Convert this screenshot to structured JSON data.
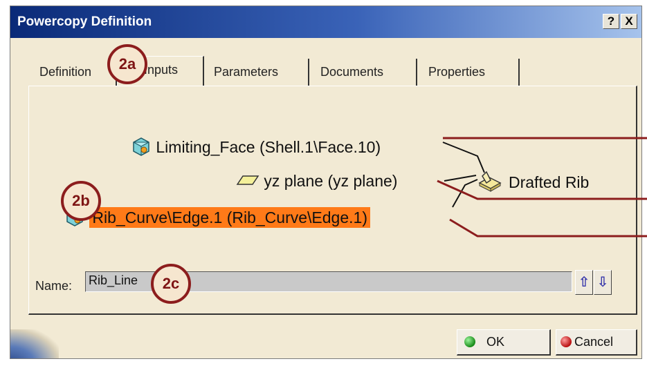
{
  "window": {
    "title": "Powercopy Definition",
    "help_label": "?",
    "close_label": "X"
  },
  "tabs": [
    {
      "label": "Definition",
      "active": false
    },
    {
      "label": "Inputs",
      "active": true
    },
    {
      "label": "Parameters",
      "active": false
    },
    {
      "label": "Documents",
      "active": false
    },
    {
      "label": "Properties",
      "active": false
    }
  ],
  "tree": {
    "inputs": [
      {
        "label": "Limiting_Face (Shell.1\\Face.10)",
        "icon": "face-icon"
      },
      {
        "label": "yz plane (yz plane)",
        "icon": "plane-icon"
      },
      {
        "label": "Rib_Curve\\Edge.1 (Rib_Curve\\Edge.1)",
        "icon": "edge-icon",
        "selected": true
      }
    ],
    "output": {
      "label": "Drafted Rib",
      "icon": "drafted-rib-icon"
    }
  },
  "name_field": {
    "label": "Name:",
    "value": "Rib_Line"
  },
  "order_buttons": {
    "up": "⇧",
    "down": "⇩"
  },
  "buttons": {
    "ok": "OK",
    "cancel": "Cancel"
  },
  "callouts": {
    "tab": "2a",
    "selection": "2b",
    "name": "2c"
  },
  "colors": {
    "highlight": "#ff7a18",
    "callout_ring": "#8c1d1d",
    "dialog_bg": "#f2ead4"
  }
}
